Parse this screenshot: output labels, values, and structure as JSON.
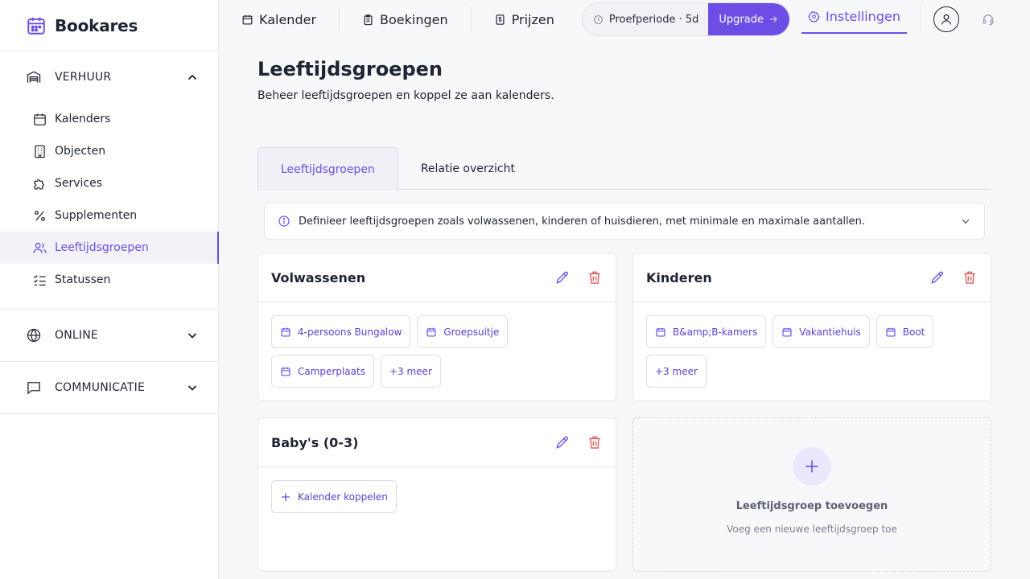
{
  "brand": {
    "name": "Bookares",
    "icon": "calendar-icon",
    "color": "#6c4ee6"
  },
  "sidebar": {
    "sections": [
      {
        "label": "VERHUUR",
        "icon": "warehouse-icon",
        "expanded": true,
        "items": [
          {
            "label": "Kalenders",
            "icon": "calendar-icon"
          },
          {
            "label": "Objecten",
            "icon": "building-icon"
          },
          {
            "label": "Services",
            "icon": "puzzle-icon"
          },
          {
            "label": "Supplementen",
            "icon": "percent-icon"
          },
          {
            "label": "Leeftijdsgroepen",
            "icon": "users-icon",
            "active": true
          },
          {
            "label": "Statussen",
            "icon": "checklist-icon"
          }
        ]
      },
      {
        "label": "ONLINE",
        "icon": "globe-icon",
        "expanded": false
      },
      {
        "label": "COMMUNICATIE",
        "icon": "message-icon",
        "expanded": false
      }
    ]
  },
  "topbar": {
    "nav": [
      {
        "label": "Kalender",
        "icon": "calendar-icon"
      },
      {
        "label": "Boekingen",
        "icon": "clipboard-icon"
      },
      {
        "label": "Prijzen",
        "icon": "price-tag-icon"
      }
    ],
    "trial": {
      "label": "Proefperiode · 5d",
      "icon": "clock-icon"
    },
    "upgrade": {
      "label": "Upgrade",
      "icon": "arrow-right-icon"
    },
    "settings": {
      "label": "Instellingen",
      "icon": "gear-icon"
    },
    "avatar_icon": "user-icon",
    "support_icon": "headset-icon"
  },
  "page": {
    "title": "Leeftijdsgroepen",
    "subtitle": "Beheer leeftijdsgroepen en koppel ze aan kalenders."
  },
  "tabs": [
    {
      "label": "Leeftijdsgroepen",
      "active": true
    },
    {
      "label": "Relatie overzicht",
      "active": false
    }
  ],
  "info": {
    "text": "Definieer leeftijdsgroepen zoals volwassenen, kinderen of huisdieren, met minimale en maximale aantallen.",
    "icon": "info-icon"
  },
  "groups": [
    {
      "title": "Volwassenen",
      "chips": [
        "4-persoons Bungalow",
        "Groepsuitje",
        "Camperplaats"
      ],
      "more": "+3 meer"
    },
    {
      "title": "Kinderen",
      "chips": [
        "B&amp;B-kamers",
        "Vakantiehuis",
        "Boot"
      ],
      "more": "+3 meer"
    },
    {
      "title": "Baby's (0-3)",
      "chips": [],
      "link_label": "Kalender koppelen"
    }
  ],
  "add_group": {
    "title": "Leeftijdsgroep toevoegen",
    "subtitle": "Voeg een nieuwe leeftijdsgroep toe",
    "icon": "plus-icon"
  },
  "colors": {
    "accent": "#6c4ee6",
    "danger": "#e05555",
    "background": "#f7f8fa"
  }
}
